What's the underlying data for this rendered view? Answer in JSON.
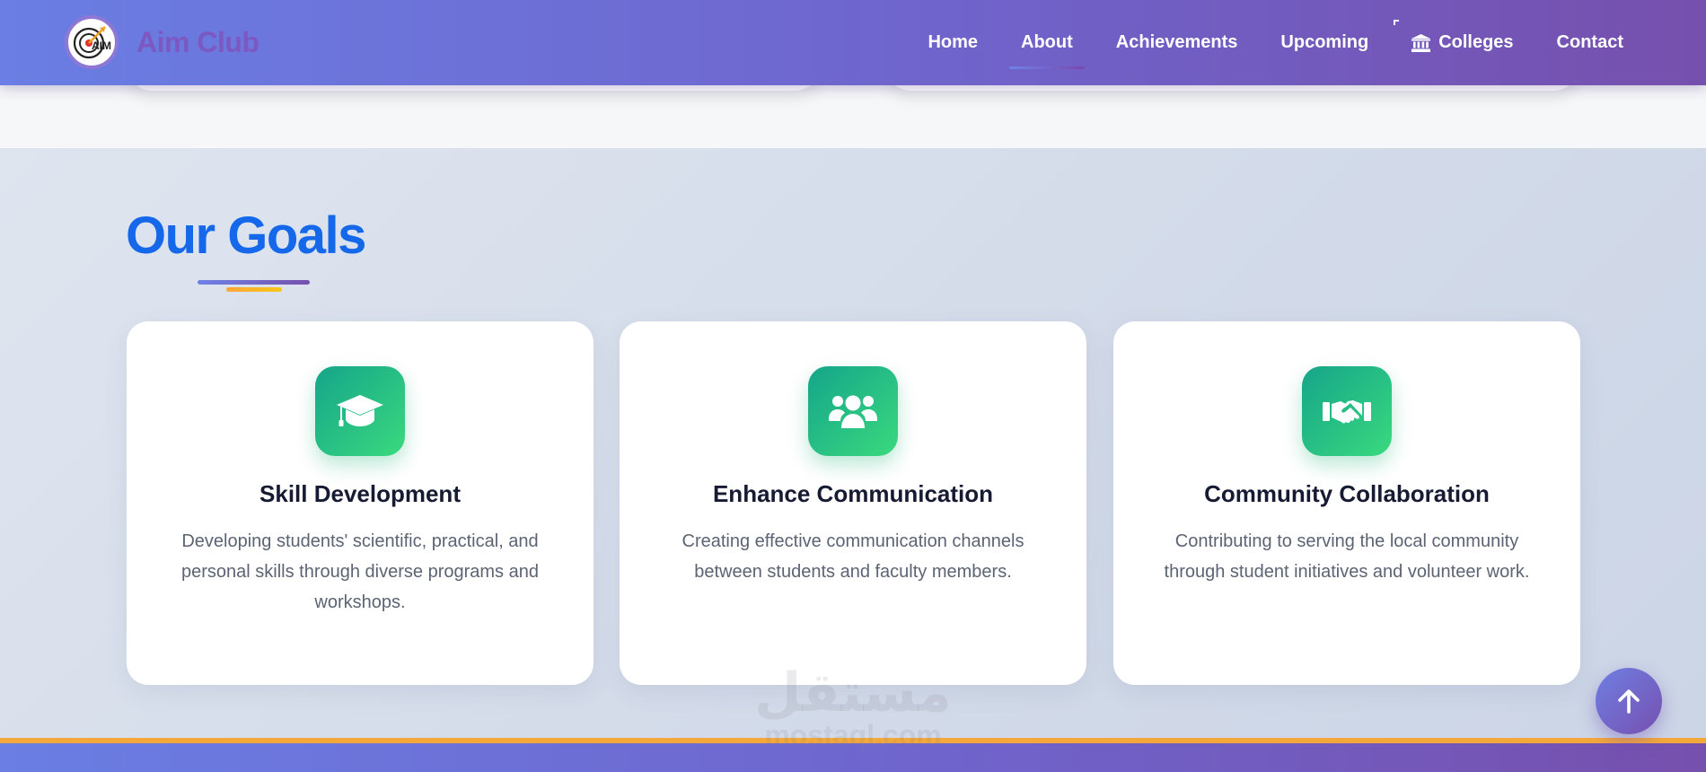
{
  "header": {
    "brand": "Aim Club",
    "logo_text": "AIM",
    "nav": [
      {
        "label": "Home"
      },
      {
        "label": "About",
        "active": true
      },
      {
        "label": "Achievements"
      },
      {
        "label": "Upcoming"
      },
      {
        "label": "Colleges",
        "icon": "building-columns-icon"
      },
      {
        "label": "Contact"
      }
    ]
  },
  "goals": {
    "title": "Our Goals",
    "cards": [
      {
        "icon": "graduation-cap-icon",
        "title": "Skill Development",
        "description": "Developing students' scientific, practical, and personal skills through diverse programs and workshops."
      },
      {
        "icon": "users-icon",
        "title": "Enhance Communication",
        "description": "Creating effective communication channels between students and faculty members."
      },
      {
        "icon": "handshake-icon",
        "title": "Community Collaboration",
        "description": "Contributing to serving the local community through student initiatives and volunteer work."
      }
    ]
  },
  "watermark": {
    "arabic": "مستقل",
    "latin": "mostaql.com"
  },
  "colors": {
    "header_start": "#6a7ee3",
    "header_end": "#7650ad",
    "title_blue": "#1668ea",
    "icon_green_start": "#15a58a",
    "icon_green_end": "#3ad97e",
    "accent_orange": "#f4a83a"
  },
  "scroll_top": {
    "icon": "arrow-up-icon"
  }
}
